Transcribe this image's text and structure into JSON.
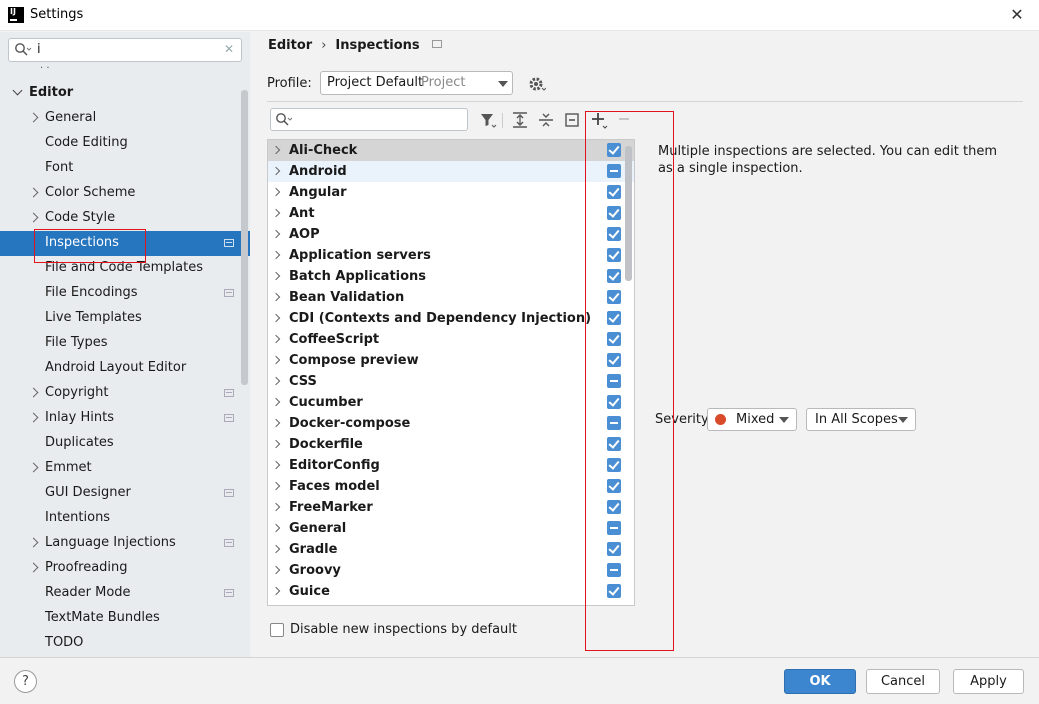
{
  "window": {
    "title": "Settings",
    "app_icon_text": "IJ"
  },
  "search": {
    "value": "i"
  },
  "sidebar": {
    "editor_label": "Editor",
    "items": [
      {
        "label": "General",
        "expandable": true,
        "project": false
      },
      {
        "label": "Code Editing",
        "expandable": false,
        "project": false
      },
      {
        "label": "Font",
        "expandable": false,
        "project": false
      },
      {
        "label": "Color Scheme",
        "expandable": true,
        "project": false
      },
      {
        "label": "Code Style",
        "expandable": true,
        "project": false
      },
      {
        "label": "Inspections",
        "expandable": false,
        "project": true,
        "selected": true
      },
      {
        "label": "File and Code Templates",
        "expandable": false,
        "project": false
      },
      {
        "label": "File Encodings",
        "expandable": false,
        "project": true
      },
      {
        "label": "Live Templates",
        "expandable": false,
        "project": false
      },
      {
        "label": "File Types",
        "expandable": false,
        "project": false
      },
      {
        "label": "Android Layout Editor",
        "expandable": false,
        "project": false
      },
      {
        "label": "Copyright",
        "expandable": true,
        "project": true
      },
      {
        "label": "Inlay Hints",
        "expandable": true,
        "project": true
      },
      {
        "label": "Duplicates",
        "expandable": false,
        "project": false
      },
      {
        "label": "Emmet",
        "expandable": true,
        "project": false
      },
      {
        "label": "GUI Designer",
        "expandable": false,
        "project": true
      },
      {
        "label": "Intentions",
        "expandable": false,
        "project": false
      },
      {
        "label": "Language Injections",
        "expandable": true,
        "project": true
      },
      {
        "label": "Proofreading",
        "expandable": true,
        "project": false
      },
      {
        "label": "Reader Mode",
        "expandable": false,
        "project": true
      },
      {
        "label": "TextMate Bundles",
        "expandable": false,
        "project": false
      },
      {
        "label": "TODO",
        "expandable": false,
        "project": false
      }
    ]
  },
  "breadcrumb": {
    "parent": "Editor",
    "separator": "›",
    "current": "Inspections"
  },
  "profile": {
    "label": "Profile:",
    "value": "Project Default",
    "scope": "Project"
  },
  "inspections": [
    {
      "label": "Ali-Check",
      "state": "check"
    },
    {
      "label": "Android",
      "state": "mixed"
    },
    {
      "label": "Angular",
      "state": "check"
    },
    {
      "label": "Ant",
      "state": "check"
    },
    {
      "label": "AOP",
      "state": "check"
    },
    {
      "label": "Application servers",
      "state": "check"
    },
    {
      "label": "Batch Applications",
      "state": "check"
    },
    {
      "label": "Bean Validation",
      "state": "check"
    },
    {
      "label": "CDI (Contexts and Dependency Injection)",
      "state": "check"
    },
    {
      "label": "CoffeeScript",
      "state": "check"
    },
    {
      "label": "Compose preview",
      "state": "check"
    },
    {
      "label": "CSS",
      "state": "mixed"
    },
    {
      "label": "Cucumber",
      "state": "check"
    },
    {
      "label": "Docker-compose",
      "state": "mixed"
    },
    {
      "label": "Dockerfile",
      "state": "check"
    },
    {
      "label": "EditorConfig",
      "state": "check"
    },
    {
      "label": "Faces model",
      "state": "check"
    },
    {
      "label": "FreeMarker",
      "state": "check"
    },
    {
      "label": "General",
      "state": "mixed"
    },
    {
      "label": "Gradle",
      "state": "check"
    },
    {
      "label": "Groovy",
      "state": "mixed"
    },
    {
      "label": "Guice",
      "state": "check"
    }
  ],
  "info": {
    "text": "Multiple inspections are selected. You can edit them as a single inspection."
  },
  "severity": {
    "label": "Severity:",
    "value": "Mixed",
    "scope": "In All Scopes"
  },
  "disable_new": {
    "label": "Disable new inspections by default",
    "checked": false
  },
  "footer": {
    "help": "?",
    "ok": "OK",
    "cancel": "Cancel",
    "apply": "Apply"
  },
  "colors": {
    "accent": "#2675bf",
    "checkbox": "#4a8fd4",
    "annotation": "#e0141c"
  }
}
